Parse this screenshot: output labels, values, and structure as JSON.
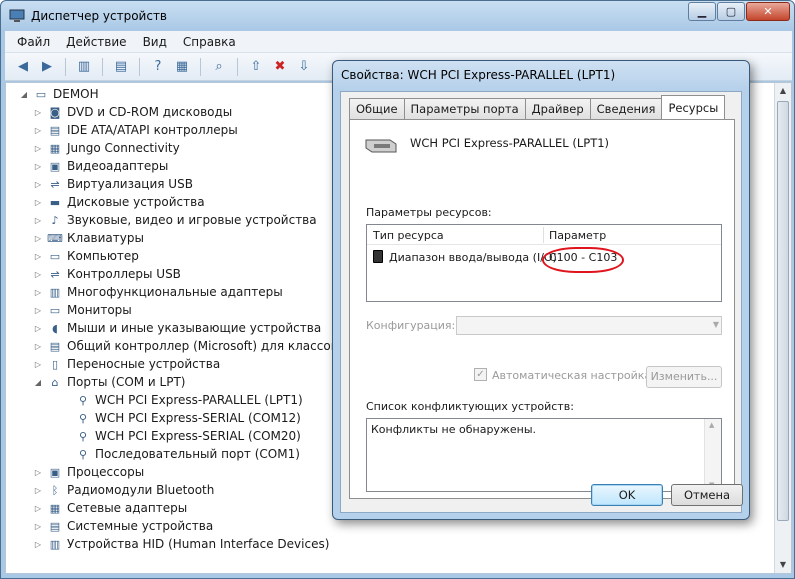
{
  "window": {
    "title": "Диспетчер устройств"
  },
  "menu": [
    "Файл",
    "Действие",
    "Вид",
    "Справка"
  ],
  "tree": {
    "root": "DEMOH",
    "categories": [
      {
        "label": "DVD и CD-ROM дисководы",
        "icon": "disc-drive-icon",
        "glyph": "◙"
      },
      {
        "label": "IDE ATA/ATAPI контроллеры",
        "icon": "ide-controller-icon",
        "glyph": "▤"
      },
      {
        "label": "Jungo Connectivity",
        "icon": "jungo-device-icon",
        "glyph": "▦"
      },
      {
        "label": "Видеоадаптеры",
        "icon": "display-adapter-icon",
        "glyph": "▣"
      },
      {
        "label": "Виртуализация USB",
        "icon": "usb-icon",
        "glyph": "⇌"
      },
      {
        "label": "Дисковые устройства",
        "icon": "disk-drive-icon",
        "glyph": "▬"
      },
      {
        "label": "Звуковые, видео и игровые устройства",
        "icon": "sound-icon",
        "glyph": "♪"
      },
      {
        "label": "Клавиатуры",
        "icon": "keyboard-icon",
        "glyph": "⌨"
      },
      {
        "label": "Компьютер",
        "icon": "computer-icon",
        "glyph": "▭"
      },
      {
        "label": "Контроллеры USB",
        "icon": "usb-controller-icon",
        "glyph": "⇌"
      },
      {
        "label": "Многофункциональные адаптеры",
        "icon": "multifunction-adapter-icon",
        "glyph": "▥"
      },
      {
        "label": "Мониторы",
        "icon": "monitor-icon",
        "glyph": "▭"
      },
      {
        "label": "Мыши и иные указывающие устройства",
        "icon": "mouse-icon",
        "glyph": "◖"
      },
      {
        "label": "Общий контроллер (Microsoft) для классов Windows",
        "icon": "controller-icon",
        "glyph": "▤"
      },
      {
        "label": "Переносные устройства",
        "icon": "portable-device-icon",
        "glyph": "▯"
      }
    ],
    "ports": {
      "label": "Порты (COM и LPT)",
      "children": [
        "WCH PCI Express-PARALLEL (LPT1)",
        "WCH PCI Express-SERIAL (COM12)",
        "WCH PCI Express-SERIAL (COM20)",
        "Последовательный порт (COM1)"
      ]
    },
    "categories_after": [
      {
        "label": "Процессоры",
        "icon": "processor-icon",
        "glyph": "▣"
      },
      {
        "label": "Радиомодули Bluetooth",
        "icon": "bluetooth-icon",
        "glyph": "ᛒ"
      },
      {
        "label": "Сетевые адаптеры",
        "icon": "network-adapter-icon",
        "glyph": "▦"
      },
      {
        "label": "Системные устройства",
        "icon": "system-device-icon",
        "glyph": "▤"
      },
      {
        "label": "Устройства HID (Human Interface Devices)",
        "icon": "hid-icon",
        "glyph": "▥"
      }
    ]
  },
  "dialog": {
    "title": "Свойства: WCH PCI Express-PARALLEL (LPT1)",
    "tabs": [
      "Общие",
      "Параметры порта",
      "Драйвер",
      "Сведения",
      "Ресурсы"
    ],
    "active_tab": "Ресурсы",
    "device_name": "WCH PCI Express-PARALLEL (LPT1)",
    "resources_label": "Параметры ресурсов:",
    "col_type": "Тип ресурса",
    "col_param": "Параметр",
    "resource_type": "Диапазон ввода/вывода (I/O)",
    "resource_value": "C100 - C103",
    "config_label": "Конфигурация:",
    "auto_label": "Автоматическая настройка",
    "change_button": "Изменить...",
    "conflicts_label": "Список конфликтующих устройств:",
    "conflicts_text": "Конфликты не обнаружены.",
    "ok": "OK",
    "cancel": "Отмена"
  },
  "colors": {
    "highlight_circle": "#e0141c",
    "title_gradient": "#b5d0ea"
  }
}
